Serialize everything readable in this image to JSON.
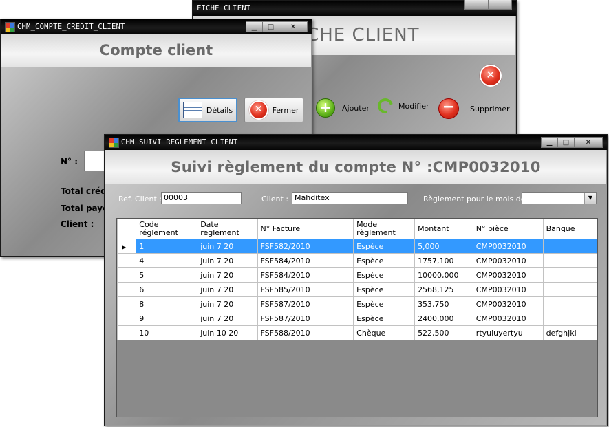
{
  "windows": {
    "fiche": {
      "title": "FICHE CLIENT",
      "header": "FICHE CLIENT",
      "buttons": {
        "ajouter": "Ajouter",
        "modifier": "Modifier",
        "supprimer": "Supprimer"
      }
    },
    "compte": {
      "title": "CHM_COMPTE_CREDIT_CLIENT",
      "header": "Compte client",
      "details_label": "Détails",
      "fermer_label": "Fermer",
      "num_label": "N° :",
      "total_credit_label": "Total crédit",
      "total_paye_label": "Total payé",
      "client_label": "Client :"
    },
    "suivi": {
      "title": "CHM_SUIVI_REGLEMENT_CLIENT",
      "header": "Suivi règlement du compte N° :CMP0032010",
      "ref_label": "Ref. Client :",
      "ref_value": "00003",
      "client_label": "Client :",
      "client_value": "Mahditex",
      "mois_label": "Règlement pour le mois de :",
      "mois_value": "",
      "grid": {
        "columns": [
          "Code\nréglement",
          "Date\nreglement",
          "N° Facture",
          "Mode\nrèglement",
          "Montant",
          "N° pièce",
          "Banque"
        ],
        "rows": [
          {
            "code": "1",
            "date": "juin  7 20",
            "facture": "FSF582/2010",
            "mode": "Espèce",
            "montant": "5,000",
            "piece": "CMP0032010",
            "banque": ""
          },
          {
            "code": "4",
            "date": "juin  7 20",
            "facture": "FSF584/2010",
            "mode": "Espèce",
            "montant": "1757,100",
            "piece": "CMP0032010",
            "banque": ""
          },
          {
            "code": "5",
            "date": "juin  7 20",
            "facture": "FSF584/2010",
            "mode": "Espèce",
            "montant": "10000,000",
            "piece": "CMP0032010",
            "banque": ""
          },
          {
            "code": "6",
            "date": "juin  7 20",
            "facture": "FSF585/2010",
            "mode": "Espèce",
            "montant": "2568,125",
            "piece": "CMP0032010",
            "banque": ""
          },
          {
            "code": "8",
            "date": "juin  7 20",
            "facture": "FSF587/2010",
            "mode": "Espèce",
            "montant": "353,750",
            "piece": "CMP0032010",
            "banque": ""
          },
          {
            "code": "9",
            "date": "juin  7 20",
            "facture": "FSF587/2010",
            "mode": "Espèce",
            "montant": "2400,000",
            "piece": "CMP0032010",
            "banque": ""
          },
          {
            "code": "10",
            "date": "juin 10 20",
            "facture": "FSF588/2010",
            "mode": "Chèque",
            "montant": "522,500",
            "piece": "rtyuiuyertyu",
            "banque": "defghjkl"
          }
        ]
      }
    }
  },
  "colors": {
    "selection": "#3399ff",
    "title_bar": "#000000",
    "header_text": "#6a6a6a"
  },
  "icons": {
    "details": "list-icon",
    "fermer": "close-icon",
    "ajouter": "plus-icon",
    "modifier": "refresh-icon",
    "supprimer": "minus-icon"
  }
}
